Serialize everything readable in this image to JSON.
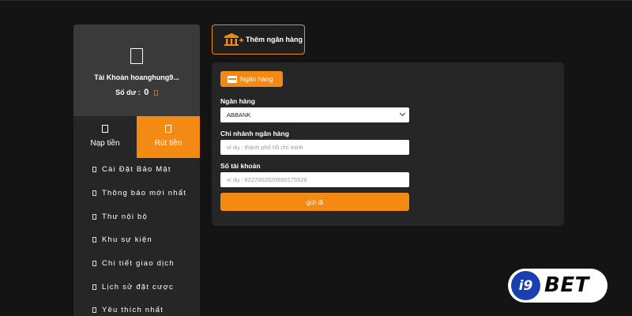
{
  "sidebar": {
    "account_label": "Tài Khoản hoanghung9...",
    "balance_label": "Số dư :",
    "balance_value": "0",
    "tabs": [
      {
        "label": "Nạp tiền",
        "icon": "deposit-icon"
      },
      {
        "label": "Rút tiền",
        "icon": "withdraw-icon",
        "active": true
      }
    ],
    "menu": [
      {
        "label": "Cài Đặt Bảo Mật"
      },
      {
        "label": "Thông báo mới nhất"
      },
      {
        "label": "Thư nội bộ"
      },
      {
        "label": "Khu sự kiện"
      },
      {
        "label": "Chi tiết giao dịch"
      },
      {
        "label": "Lịch sử đặt cược"
      },
      {
        "label": "Yêu thích nhất"
      }
    ]
  },
  "add_bank": {
    "label": "Thêm ngân hàng",
    "icon": "bank-add-icon"
  },
  "form": {
    "section_pill": "Ngân hàng",
    "bank_label": "Ngân hàng",
    "bank_value": "ABBANK",
    "branch_label": "Chi nhánh ngân hàng",
    "branch_placeholder": "ví dụ : thành phố hồ chí minh",
    "account_label": "Số tài khoản",
    "account_placeholder": "ví dụ : 6227002020690175526",
    "submit_label": "gửi đi"
  },
  "logo": {
    "badge": "i9",
    "brand": "BET"
  },
  "colors": {
    "accent": "#f28a14",
    "background": "#141414",
    "panel": "#262626",
    "logo_blue": "#1a3fb0"
  }
}
